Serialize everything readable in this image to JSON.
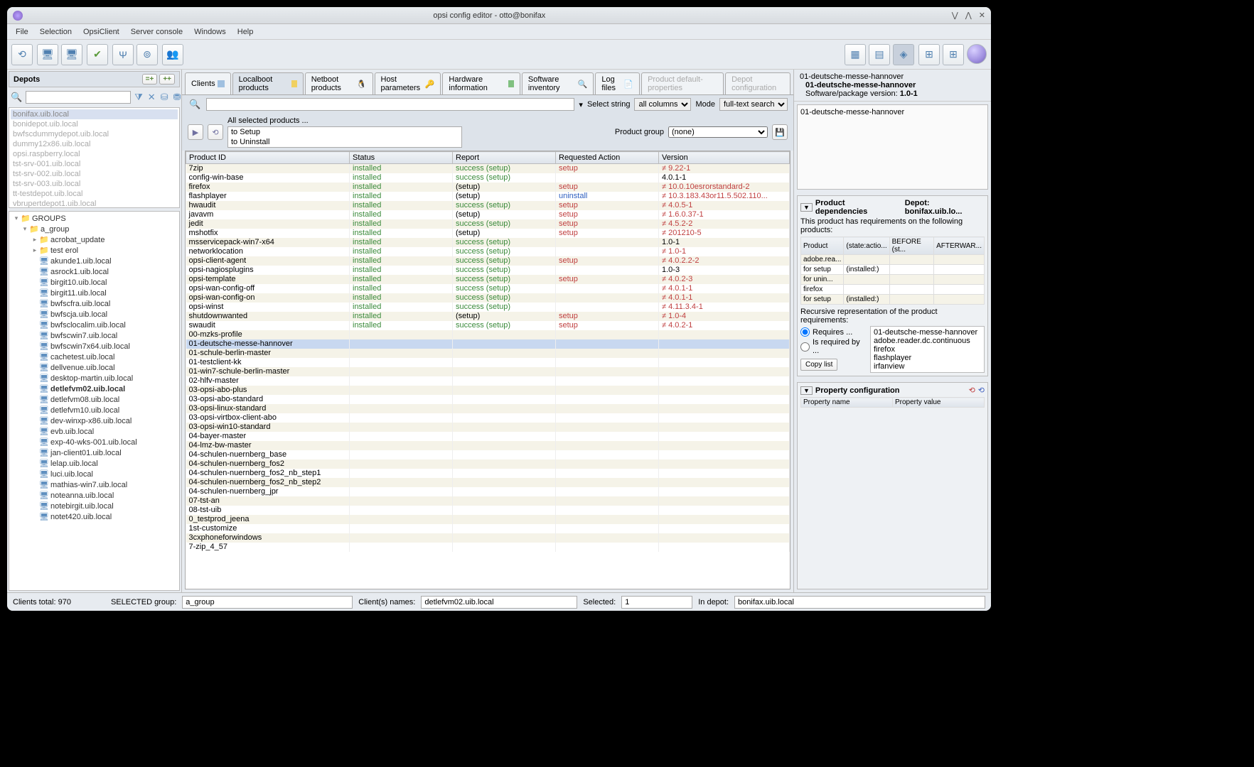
{
  "window": {
    "title": "opsi config editor - otto@bonifax"
  },
  "menubar": [
    "File",
    "Selection",
    "OpsiClient",
    "Server console",
    "Windows",
    "Help"
  ],
  "depots": {
    "title": "Depots",
    "items": [
      "bonifax.uib.local",
      "bonidepot.uib.local",
      "bwfscdummydepot.uib.local",
      "dummy12x86.uib.local",
      "opsi.raspberry.local",
      "tst-srv-001.uib.local",
      "tst-srv-002.uib.local",
      "tst-srv-003.uib.local",
      "tt-testdepot.uib.local",
      "vbrupertdepot1.uib.local"
    ]
  },
  "tree": {
    "root": "GROUPS",
    "group": "a_group",
    "sub1": "acrobat_update",
    "sub2": "test erol",
    "clients": [
      "akunde1.uib.local",
      "asrock1.uib.local",
      "birgit10.uib.local",
      "birgit11.uib.local",
      "bwfscfra.uib.local",
      "bwfscja.uib.local",
      "bwfsclocalim.uib.local",
      "bwfscwin7.uib.local",
      "bwfscwin7x64.uib.local",
      "cachetest.uib.local",
      "dellvenue.uib.local",
      "desktop-martin.uib.local",
      "detlefvm02.uib.local",
      "detlefvm08.uib.local",
      "detlefvm10.uib.local",
      "dev-winxp-x86.uib.local",
      "evb.uib.local",
      "exp-40-wks-001.uib.local",
      "jan-client01.uib.local",
      "lelap.uib.local",
      "luci.uib.local",
      "mathias-win7.uib.local",
      "noteanna.uib.local",
      "notebirgit.uib.local",
      "notet420.uib.local"
    ]
  },
  "tabs": [
    "Clients",
    "Localboot products",
    "Netboot products",
    "Host parameters",
    "Hardware information",
    "Software inventory",
    "Log files",
    "Product default-properties",
    "Depot configuration"
  ],
  "search": {
    "select_string": "Select string",
    "all_columns": "all columns",
    "mode": "Mode",
    "full_text": "full-text search"
  },
  "actions": {
    "all_selected": "All selected products ...",
    "setup": "to Setup",
    "uninstall": "to Uninstall",
    "product_group": "Product group",
    "none": "(none)"
  },
  "columns": [
    "Product ID",
    "Status",
    "Report",
    "Requested Action",
    "Version"
  ],
  "rows": [
    {
      "id": "7zip",
      "st": "installed",
      "rp": "success (setup)",
      "ra": "setup",
      "v": "≠ 9.22-1",
      "vr": 1
    },
    {
      "id": "config-win-base",
      "st": "installed",
      "rp": "success (setup)",
      "ra": "",
      "v": "4.0.1-1"
    },
    {
      "id": "firefox",
      "st": "installed",
      "rp": "(setup)",
      "ra": "setup",
      "v": "≠ 10.0.10esrorstandard-2",
      "vr": 1,
      "rpb": 1
    },
    {
      "id": "flashplayer",
      "st": "installed",
      "rp": "(setup)",
      "ra": "uninstall",
      "rab": 1,
      "v": "≠ 10.3.183.43or11.5.502.110...",
      "vr": 1,
      "rpb": 1
    },
    {
      "id": "hwaudit",
      "st": "installed",
      "rp": "success (setup)",
      "ra": "setup",
      "v": "≠ 4.0.5-1",
      "vr": 1
    },
    {
      "id": "javavm",
      "st": "installed",
      "rp": "(setup)",
      "ra": "setup",
      "v": "≠ 1.6.0.37-1",
      "vr": 1,
      "rpb": 1
    },
    {
      "id": "jedit",
      "st": "installed",
      "rp": "success (setup)",
      "ra": "setup",
      "v": "≠ 4.5.2-2",
      "vr": 1
    },
    {
      "id": "mshotfix",
      "st": "installed",
      "rp": "(setup)",
      "ra": "setup",
      "v": "≠ 201210-5",
      "vr": 1,
      "rpb": 1
    },
    {
      "id": "msservicepack-win7-x64",
      "st": "installed",
      "rp": "success (setup)",
      "ra": "",
      "v": "1.0-1"
    },
    {
      "id": "networklocation",
      "st": "installed",
      "rp": "success (setup)",
      "ra": "",
      "v": "≠ 1.0-1",
      "vr": 1
    },
    {
      "id": "opsi-client-agent",
      "st": "installed",
      "rp": "success (setup)",
      "ra": "setup",
      "v": "≠ 4.0.2.2-2",
      "vr": 1
    },
    {
      "id": "opsi-nagiosplugins",
      "st": "installed",
      "rp": "success (setup)",
      "ra": "",
      "v": "1.0-3"
    },
    {
      "id": "opsi-template",
      "st": "installed",
      "rp": "success (setup)",
      "ra": "setup",
      "v": "≠ 4.0.2-3",
      "vr": 1
    },
    {
      "id": "opsi-wan-config-off",
      "st": "installed",
      "rp": "success (setup)",
      "ra": "",
      "v": "≠ 4.0.1-1",
      "vr": 1
    },
    {
      "id": "opsi-wan-config-on",
      "st": "installed",
      "rp": "success (setup)",
      "ra": "",
      "v": "≠ 4.0.1-1",
      "vr": 1
    },
    {
      "id": "opsi-winst",
      "st": "installed",
      "rp": "success (setup)",
      "ra": "",
      "v": "≠ 4.11.3.4-1",
      "vr": 1
    },
    {
      "id": "shutdownwanted",
      "st": "installed",
      "rp": "(setup)",
      "ra": "setup",
      "v": "≠ 1.0-4",
      "vr": 1,
      "rpb": 1
    },
    {
      "id": "swaudit",
      "st": "installed",
      "rp": "success (setup)",
      "ra": "setup",
      "v": "≠ 4.0.2-1",
      "vr": 1
    },
    {
      "id": "00-mzks-profile"
    },
    {
      "id": "01-deutsche-messe-hannover",
      "sel": 1
    },
    {
      "id": "01-schule-berlin-master"
    },
    {
      "id": "01-testclient-kk"
    },
    {
      "id": "01-win7-schule-berlin-master"
    },
    {
      "id": "02-hlfv-master"
    },
    {
      "id": "03-opsi-abo-plus"
    },
    {
      "id": "03-opsi-abo-standard"
    },
    {
      "id": "03-opsi-linux-standard"
    },
    {
      "id": "03-opsi-virtbox-client-abo"
    },
    {
      "id": "03-opsi-win10-standard"
    },
    {
      "id": "04-bayer-master"
    },
    {
      "id": "04-lmz-bw-master"
    },
    {
      "id": "04-schulen-nuernberg_base"
    },
    {
      "id": "04-schulen-nuernberg_fos2"
    },
    {
      "id": "04-schulen-nuernberg_fos2_nb_step1"
    },
    {
      "id": "04-schulen-nuernberg_fos2_nb_step2"
    },
    {
      "id": "04-schulen-nuernberg_jpr"
    },
    {
      "id": "07-tst-an"
    },
    {
      "id": "08-tst-uib"
    },
    {
      "id": "0_testprod_jeena"
    },
    {
      "id": "1st-customize"
    },
    {
      "id": "3cxphoneforwindows"
    },
    {
      "id": "7-zip_4_57"
    }
  ],
  "right": {
    "prod": "01-deutsche-messe-hannover",
    "prod_bold": "01-deutsche-messe-hannover",
    "version_label": "Software/package version:",
    "version": "1.0-1",
    "desc": "01-deutsche-messe-hannover",
    "dep_title": "Product dependencies",
    "depot": "Depot: bonifax.uib.lo...",
    "dep_hint": "This product has requirements on the following products:",
    "dep_cols": [
      "Product",
      "(state:actio...",
      "BEFORE (st...",
      "AFTERWAR..."
    ],
    "dep_rows": [
      {
        "p": "adobe.rea..."
      },
      {
        "p": "  for setup",
        "s": "(installed:)"
      },
      {
        "p": "  for unin..."
      },
      {
        "p": "firefox"
      },
      {
        "p": "  for setup",
        "s": "(installed:)"
      }
    ],
    "recursive": "Recursive representation of the product requirements:",
    "requires": "Requires ...",
    "required_by": "Is required by ...",
    "req_list": [
      "01-deutsche-messe-hannover",
      "  adobe.reader.dc.continuous",
      "  firefox",
      "  flashplayer",
      "  irfanview"
    ],
    "copy": "Copy list",
    "prop_title": "Property configuration",
    "prop_cols": [
      "Property name",
      "Property value"
    ]
  },
  "status": {
    "clients_total": "Clients total:  970",
    "selected_label": "SELECTED   group:",
    "group": "a_group",
    "client_names": "Client(s) names:",
    "client_val": "detlefvm02.uib.local",
    "selected": "Selected:",
    "selected_val": "1",
    "in_depot": "In depot:",
    "depot_val": "bonifax.uib.local"
  }
}
